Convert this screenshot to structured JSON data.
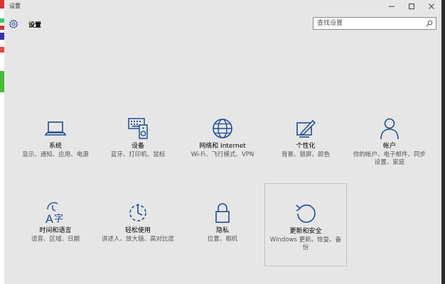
{
  "window": {
    "title": "设置"
  },
  "header": {
    "title": "设置",
    "icon": "gear-icon"
  },
  "search": {
    "placeholder": "查找设置",
    "icon": "search-icon"
  },
  "colors": {
    "accent": "#1e4d9a",
    "background": "#e6e6e6"
  },
  "tiles": [
    {
      "name": "系统",
      "desc": "显示、通知、应用、电源",
      "icon": "laptop-icon"
    },
    {
      "name": "设备",
      "desc": "蓝牙、打印机、鼠标",
      "icon": "devices-icon"
    },
    {
      "name": "网络和 Internet",
      "desc": "Wi-Fi、飞行模式、VPN",
      "icon": "globe-icon"
    },
    {
      "name": "个性化",
      "desc": "背景、锁屏、颜色",
      "icon": "personalize-icon"
    },
    {
      "name": "帐户",
      "desc": "你的帐户、电子邮件、同步设置、家庭",
      "icon": "person-icon"
    },
    {
      "name": "时间和语言",
      "desc": "语音、区域、日期",
      "icon": "time-language-icon"
    },
    {
      "name": "轻松使用",
      "desc": "讲述人、放大镜、高对比度",
      "icon": "ease-of-access-icon"
    },
    {
      "name": "隐私",
      "desc": "位置、相机",
      "icon": "lock-icon"
    },
    {
      "name": "更新和安全",
      "desc": "Windows 更新、恢复、备份",
      "icon": "update-icon"
    }
  ]
}
